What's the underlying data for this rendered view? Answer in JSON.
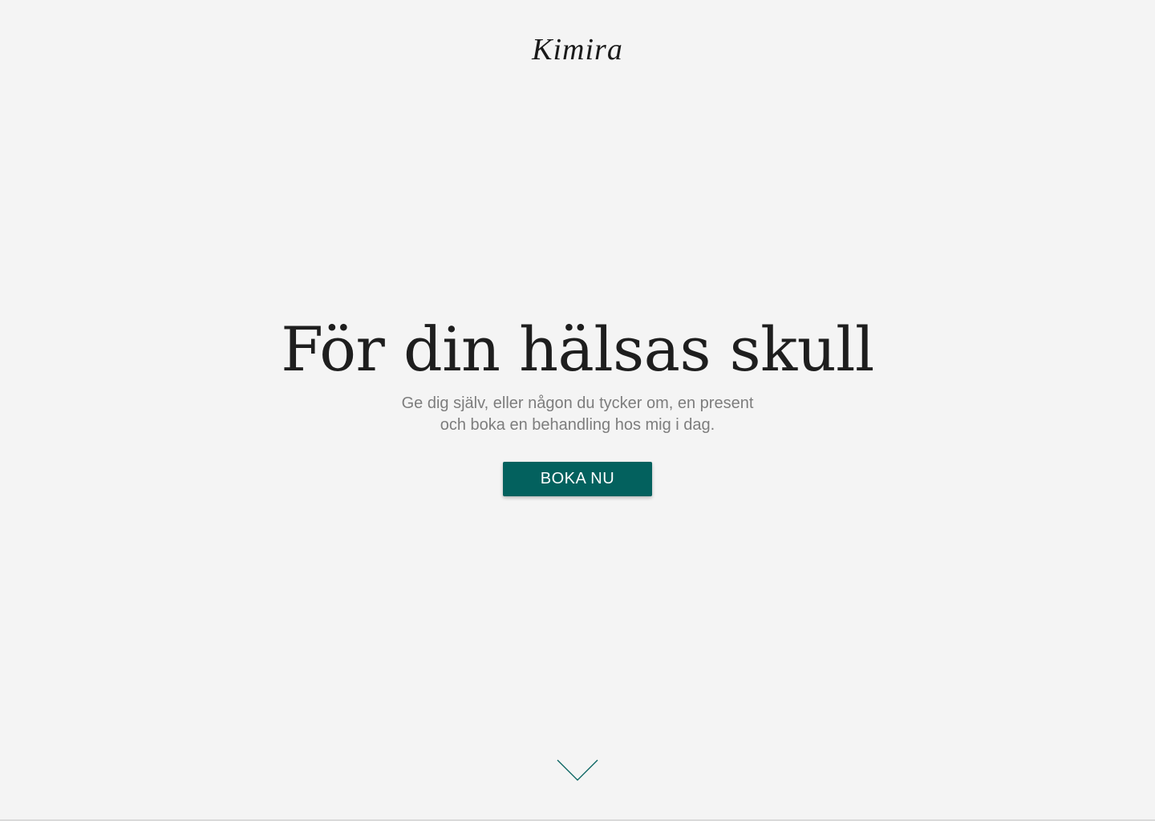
{
  "brand": {
    "logo_text": "Kimira"
  },
  "hero": {
    "headline": "För din hälsas skull",
    "subline_line1": "Ge dig själv, eller någon du tycker om, en present",
    "subline_line2": "och boka en behandling hos mig i dag.",
    "cta_label": "BOKA NU"
  },
  "icons": {
    "scroll_down": "chevron-down-icon"
  },
  "colors": {
    "background": "#f4f4f4",
    "accent": "#03615e",
    "headline": "#1e1e1e",
    "subline": "#7d7d7d"
  }
}
